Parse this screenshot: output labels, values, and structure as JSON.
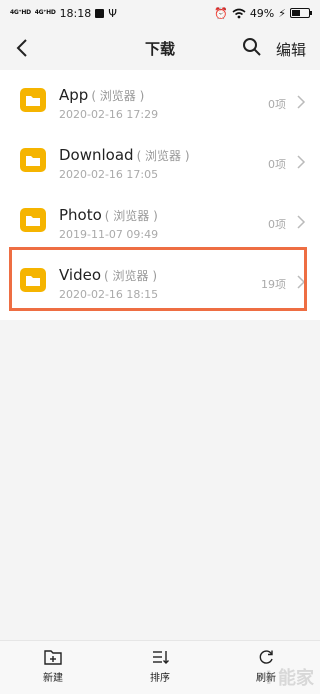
{
  "status_bar": {
    "signal1": "4G⁺HD",
    "signal2": "4G⁺HD",
    "time": "18:18",
    "battery": "49%",
    "icons": [
      "signal-icon",
      "notification-icon",
      "usb-icon",
      "alarm-icon",
      "wifi-icon",
      "battery-icon"
    ]
  },
  "header": {
    "title": "下载",
    "edit_label": "编辑",
    "back_icon": "chevron-left-icon",
    "search_icon": "search-icon"
  },
  "folders": [
    {
      "name": "App",
      "source": "( 浏览器 )",
      "date": "2020-02-16 17:29",
      "count": "0项"
    },
    {
      "name": "Download",
      "source": "( 浏览器 )",
      "date": "2020-02-16 17:05",
      "count": "0项"
    },
    {
      "name": "Photo",
      "source": "( 浏览器 )",
      "date": "2019-11-07 09:49",
      "count": "0项"
    },
    {
      "name": "Video",
      "source": "( 浏览器 )",
      "date": "2020-02-16 18:15",
      "count": "19项"
    }
  ],
  "bottom_bar": {
    "new_label": "新建",
    "sort_label": "排序",
    "refresh_label": "刷新"
  },
  "watermark": "i 能家",
  "colors": {
    "folder": "#f5b400",
    "highlight": "#ee6e43",
    "secondary_text": "#aaaaaa"
  }
}
